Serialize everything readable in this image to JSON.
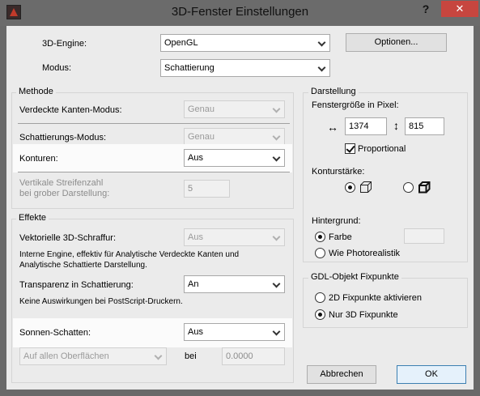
{
  "window": {
    "title": "3D-Fenster Einstellungen",
    "help": "?",
    "close": "✕"
  },
  "top": {
    "engine_label": "3D-Engine:",
    "engine_value": "OpenGL",
    "options_button": "Optionen...",
    "mode_label": "Modus:",
    "mode_value": "Schattierung"
  },
  "methode": {
    "title": "Methode",
    "hidden_edges_label": "Verdeckte Kanten-Modus:",
    "hidden_edges_value": "Genau",
    "shading_label": "Schattierungs-Modus:",
    "shading_value": "Genau",
    "contours_label": "Konturen:",
    "contours_value": "Aus",
    "stripes_label_1": "Vertikale Streifenzahl",
    "stripes_label_2": "bei grober Darstellung:",
    "stripes_value": "5"
  },
  "effekte": {
    "title": "Effekte",
    "hatching_label": "Vektorielle 3D-Schraffur:",
    "hatching_value": "Aus",
    "hatching_note_1": "Interne Engine, effektiv für Analytische Verdeckte Kanten und",
    "hatching_note_2": "Analytische Schattierte Darstellung.",
    "transparency_label": "Transparenz in Schattierung:",
    "transparency_value": "An",
    "transparency_note": "Keine Auswirkungen bei PostScript-Druckern.",
    "sun_label": "Sonnen-Schatten:",
    "sun_value": "Aus",
    "surfaces_value": "Auf allen Oberflächen",
    "at_label": "bei",
    "at_value": "0.0000"
  },
  "darstellung": {
    "title": "Darstellung",
    "size_label": "Fenstergröße in Pixel:",
    "width_icon": "↔",
    "width_value": "1374",
    "height_icon": "↕",
    "height_value": "815",
    "proportional_label": "Proportional",
    "proportional_checked": true,
    "contour_strength_label": "Konturstärke:",
    "contour_thin_selected": true,
    "background_label": "Hintergrund:",
    "bg_color_label": "Farbe",
    "bg_color_selected": true,
    "bg_photo_label": "Wie Photorealistik"
  },
  "gdl": {
    "title": "GDL-Objekt Fixpunkte",
    "opt1_label": "2D Fixpunkte aktivieren",
    "opt2_label": "Nur 3D Fixpunkte",
    "selected": "opt2"
  },
  "footer": {
    "cancel_button": "Abbrechen",
    "ok_button": "OK"
  }
}
